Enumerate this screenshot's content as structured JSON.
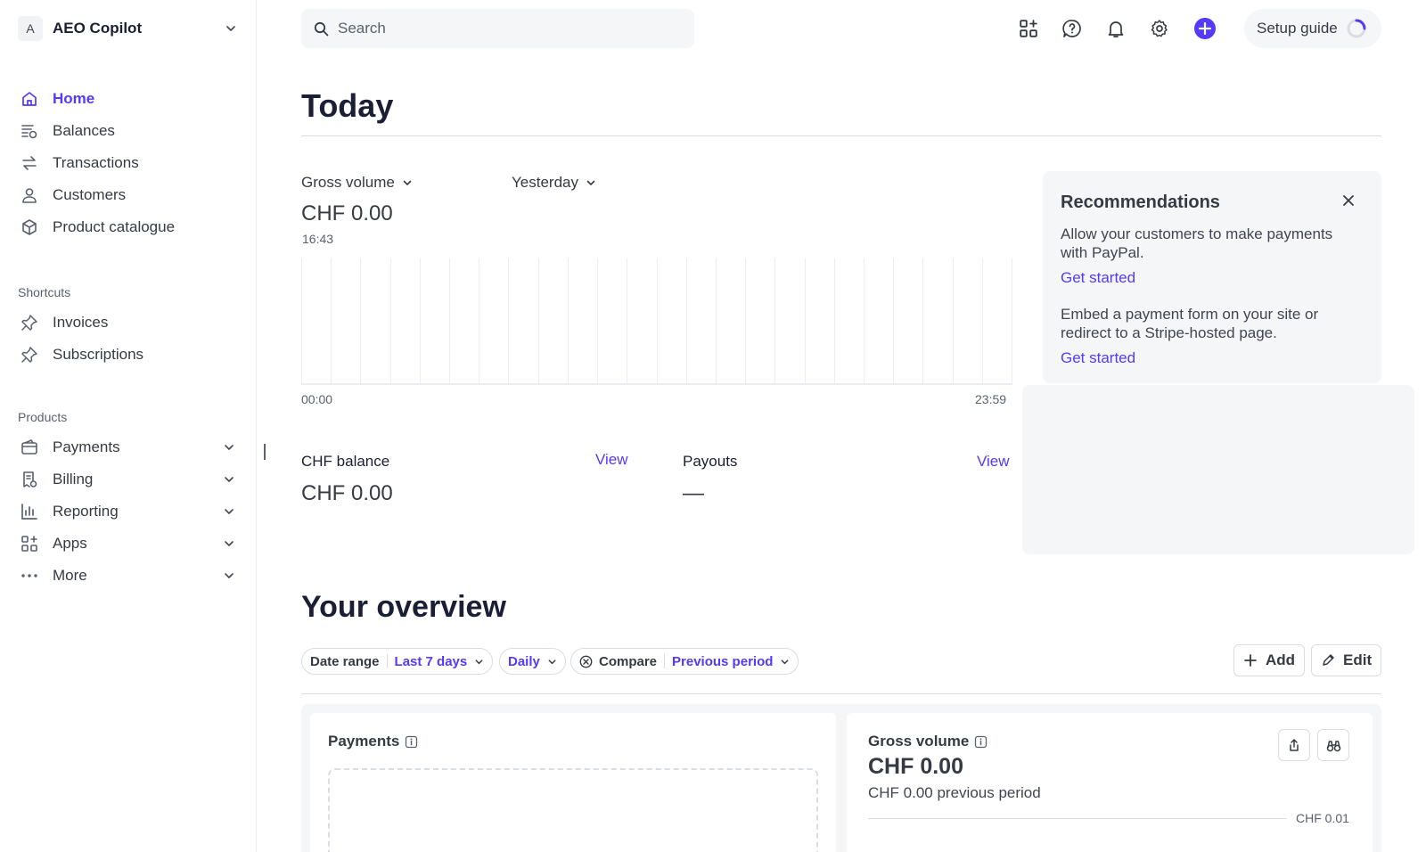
{
  "account": {
    "initial": "A",
    "name": "AEO Copilot"
  },
  "nav": {
    "home": "Home",
    "balances": "Balances",
    "transactions": "Transactions",
    "customers": "Customers",
    "product_catalogue": "Product catalogue"
  },
  "shortcuts": {
    "title": "Shortcuts",
    "invoices": "Invoices",
    "subscriptions": "Subscriptions"
  },
  "products": {
    "title": "Products",
    "payments": "Payments",
    "billing": "Billing",
    "reporting": "Reporting",
    "apps": "Apps",
    "more": "More"
  },
  "header": {
    "search_placeholder": "Search",
    "setup_guide": "Setup guide"
  },
  "today": {
    "title": "Today",
    "metric_select": "Gross volume",
    "period_select": "Yesterday",
    "amount": "CHF 0.00",
    "time": "16:43",
    "axis_start": "00:00",
    "axis_end": "23:59",
    "balance_label": "CHF balance",
    "balance_amount": "CHF 0.00",
    "balance_link": "View",
    "payouts_label": "Payouts",
    "payouts_value": "—",
    "payouts_link": "View"
  },
  "recommendations": {
    "title": "Recommendations",
    "items": [
      {
        "text": "Allow your customers to make payments with PayPal.",
        "link": "Get started"
      },
      {
        "text": "Embed a payment form on your site or redirect to a Stripe-hosted page.",
        "link": "Get started"
      }
    ]
  },
  "overview": {
    "title": "Your overview",
    "date_range_label": "Date range",
    "date_range_value": "Last 7 days",
    "interval": "Daily",
    "compare_label": "Compare",
    "compare_value": "Previous period",
    "add_label": "Add",
    "edit_label": "Edit",
    "payments_card": {
      "title": "Payments"
    },
    "gross_volume_card": {
      "title": "Gross volume",
      "amount": "CHF 0.00",
      "previous": "CHF 0.00 previous period",
      "tick": "CHF 0.01"
    }
  },
  "colors": {
    "accent": "#533afd",
    "text": "#1a1f36",
    "muted": "#596171",
    "panel": "#f5f6f8",
    "border": "#d8dde3"
  },
  "icons": {
    "home": "home-icon",
    "balances": "balances-icon",
    "transactions": "transactions-icon",
    "customers": "customer-icon",
    "product": "box-icon",
    "shortcut": "pin-icon",
    "payments": "wallet-icon",
    "billing": "receipt-icon",
    "reporting": "bar-chart-icon",
    "apps": "apps-icon",
    "more": "ellipsis-icon"
  }
}
